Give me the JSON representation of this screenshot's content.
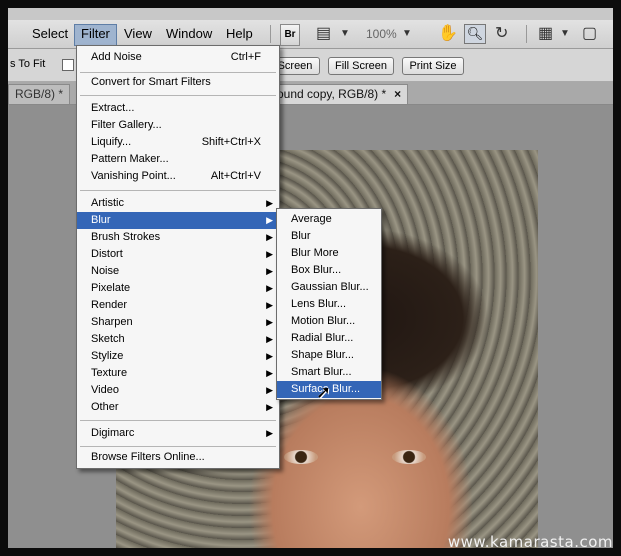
{
  "menubar": {
    "items": [
      "Select",
      "Filter",
      "View",
      "Window",
      "Help"
    ],
    "bridge_label": "Br",
    "zoom": "100%"
  },
  "options": {
    "fit_label": "s To Fit",
    "screen_btn": "Screen",
    "fill_screen_btn": "Fill Screen",
    "print_size_btn": "Print Size"
  },
  "tabs": {
    "tab1": "RGB/8) *",
    "tab2": "ound copy, RGB/8) *",
    "close": "×"
  },
  "filter_menu": {
    "items": [
      {
        "label": "Add Noise",
        "shortcut": "Ctrl+F"
      },
      {
        "label": "Convert for Smart Filters"
      },
      {
        "label": "Extract..."
      },
      {
        "label": "Filter Gallery..."
      },
      {
        "label": "Liquify...",
        "shortcut": "Shift+Ctrl+X"
      },
      {
        "label": "Pattern Maker..."
      },
      {
        "label": "Vanishing Point...",
        "shortcut": "Alt+Ctrl+V"
      },
      {
        "label": "Artistic"
      },
      {
        "label": "Blur"
      },
      {
        "label": "Brush Strokes"
      },
      {
        "label": "Distort"
      },
      {
        "label": "Noise"
      },
      {
        "label": "Pixelate"
      },
      {
        "label": "Render"
      },
      {
        "label": "Sharpen"
      },
      {
        "label": "Sketch"
      },
      {
        "label": "Stylize"
      },
      {
        "label": "Texture"
      },
      {
        "label": "Video"
      },
      {
        "label": "Other"
      },
      {
        "label": "Digimarc"
      },
      {
        "label": "Browse Filters Online..."
      }
    ]
  },
  "blur_menu": {
    "items": [
      "Average",
      "Blur",
      "Blur More",
      "Box Blur...",
      "Gaussian Blur...",
      "Lens Blur...",
      "Motion Blur...",
      "Radial Blur...",
      "Shape Blur...",
      "Smart Blur...",
      "Surface Blur..."
    ]
  },
  "watermark": "www.kamarasta.com",
  "colors": {
    "highlight": "#3466b7",
    "menu_bg": "#f6f6f6"
  }
}
